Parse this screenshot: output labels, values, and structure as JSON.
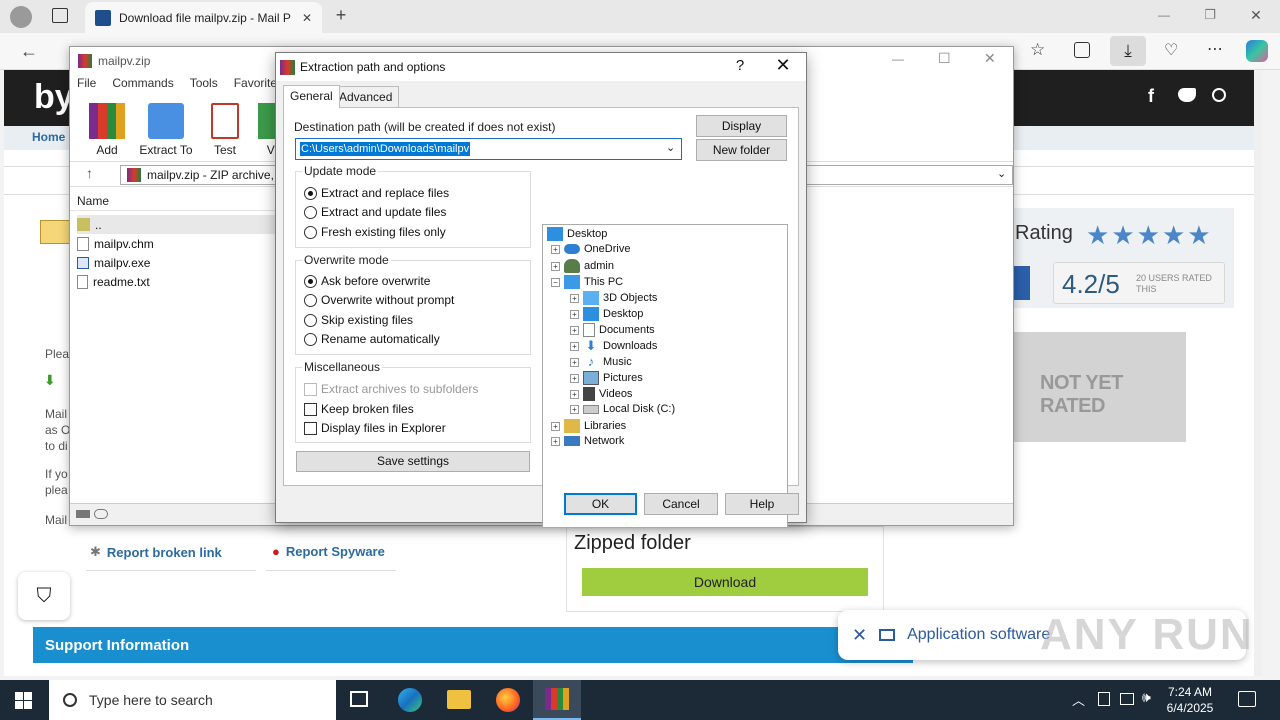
{
  "browser": {
    "tab_title": "Download file mailpv.zip - Mail P",
    "new_tab": "+",
    "window_controls": {
      "minimize": "—",
      "maximize": "❐",
      "close": "✕"
    }
  },
  "site": {
    "logo": "by",
    "nav_home": "Home",
    "rating_label": "Rating",
    "score": "4.2/5",
    "score_sub": "20 USERS RATED THIS",
    "not_rated": "NOT YET RATED",
    "report_broken": "Report broken link",
    "report_spyware": "Report Spyware",
    "zipped_folder": "Zipped folder",
    "download": "Download",
    "support": "Support Information",
    "toast": "Application software",
    "watermark": "ANY RUN",
    "side_lines": [
      "Plea",
      "Mail",
      "as O",
      "to di",
      "If yo",
      "plea",
      "Mail"
    ]
  },
  "winrar": {
    "title": "mailpv.zip",
    "menu": [
      "File",
      "Commands",
      "Tools",
      "Favorites"
    ],
    "toolbar": [
      "Add",
      "Extract To",
      "Test",
      "Vi"
    ],
    "path": "mailpv.zip - ZIP archive,",
    "col_name": "Name",
    "files": [
      "..",
      "mailpv.chm",
      "mailpv.exe",
      "readme.txt"
    ]
  },
  "dialog": {
    "title": "Extraction path and options",
    "help": "?",
    "close": "✕",
    "tabs": [
      "General",
      "Advanced"
    ],
    "dest_label": "Destination path (will be created if does not exist)",
    "dest_value": "C:\\Users\\admin\\Downloads\\mailpv",
    "display_btn": "Display",
    "new_folder_btn": "New folder",
    "update_mode": {
      "label": "Update mode",
      "options": [
        "Extract and replace files",
        "Extract and update files",
        "Fresh existing files only"
      ],
      "selected": 0
    },
    "overwrite_mode": {
      "label": "Overwrite mode",
      "options": [
        "Ask before overwrite",
        "Overwrite without prompt",
        "Skip existing files",
        "Rename automatically"
      ],
      "selected": 0
    },
    "misc": {
      "label": "Miscellaneous",
      "options": [
        "Extract archives to subfolders",
        "Keep broken files",
        "Display files in Explorer"
      ]
    },
    "save_settings": "Save settings",
    "tree": [
      "Desktop",
      "OneDrive",
      "admin",
      "This PC",
      "3D Objects",
      "Desktop",
      "Documents",
      "Downloads",
      "Music",
      "Pictures",
      "Videos",
      "Local Disk (C:)",
      "Libraries",
      "Network"
    ],
    "ok": "OK",
    "cancel": "Cancel",
    "help_btn": "Help"
  },
  "taskbar": {
    "search_placeholder": "Type here to search",
    "time": "7:24 AM",
    "date": "6/4/2025"
  },
  "colors": {
    "accent": "#0078d7",
    "download_green": "#9fcd3f",
    "support_blue": "#1a8fd0",
    "star_blue": "#4a86c8"
  }
}
